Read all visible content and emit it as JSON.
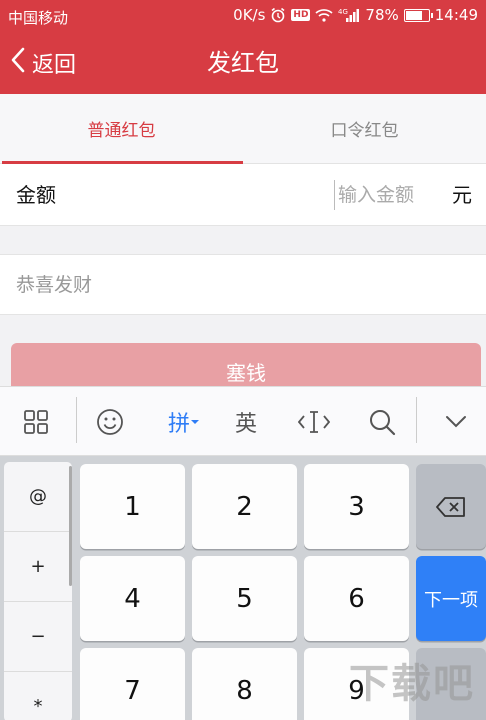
{
  "status_bar": {
    "carrier": "中国移动",
    "network_speed": "0K/s",
    "hd_badge": "HD",
    "signal_label": "4G",
    "battery": "78%",
    "battery_level": 0.78,
    "time": "14:49"
  },
  "header": {
    "back_label": "返回",
    "title": "发红包"
  },
  "tabs": [
    {
      "label": "普通红包",
      "active": true
    },
    {
      "label": "口令红包",
      "active": false
    }
  ],
  "amount": {
    "label": "金额",
    "placeholder": "输入金额",
    "value": "",
    "unit": "元"
  },
  "message": {
    "placeholder": "恭喜发财",
    "value": ""
  },
  "submit": {
    "label": "塞钱"
  },
  "keyboard": {
    "toolbar": {
      "pinyin_label": "拼",
      "english_label": "英"
    },
    "symbol_keys": [
      "@",
      "+",
      "−",
      "*"
    ],
    "number_keys": [
      "1",
      "2",
      "3",
      "4",
      "5",
      "6",
      "7",
      "8",
      "9"
    ],
    "next_label": "下一项"
  },
  "watermark": "下载吧",
  "colors": {
    "brand_red": "#d73c43",
    "accent_blue": "#2f80f7"
  }
}
